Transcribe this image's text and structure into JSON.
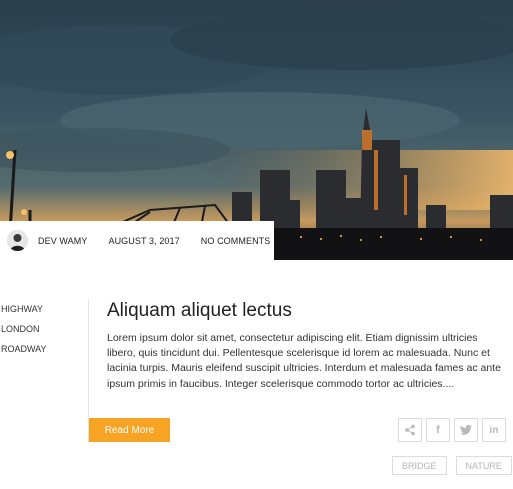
{
  "post": {
    "author": "DEV WAMY",
    "date": "AUGUST 3, 2017",
    "comments": "NO COMMENTS",
    "title": "Aliquam aliquet lectus",
    "excerpt": "Lorem ipsum dolor sit amet, consectetur adipiscing elit. Etiam dignissim ultricies libero, quis tincidunt dui. Pellentesque scelerisque id lorem ac malesuada. Nunc et lacinia turpis. Mauris eleifend suscipit ultricies. Interdum et malesuada fames ac ante ipsum primis in faucibus. Integer scelerisque commodo tortor ac ultricies....",
    "read_more": "Read More"
  },
  "categories": [
    "HIGHWAY",
    "LONDON",
    "ROADWAY"
  ],
  "share": {
    "icons": [
      "share-icon",
      "facebook-icon",
      "twitter-icon",
      "linkedin-icon"
    ],
    "facebook_glyph": "f",
    "linkedin_glyph": "in"
  },
  "tags": [
    "BRIDGE",
    "NATURE"
  ],
  "colors": {
    "accent": "#f7a425",
    "border": "#dcdcdc",
    "text": "#222222",
    "muted": "#b5b5b5"
  }
}
